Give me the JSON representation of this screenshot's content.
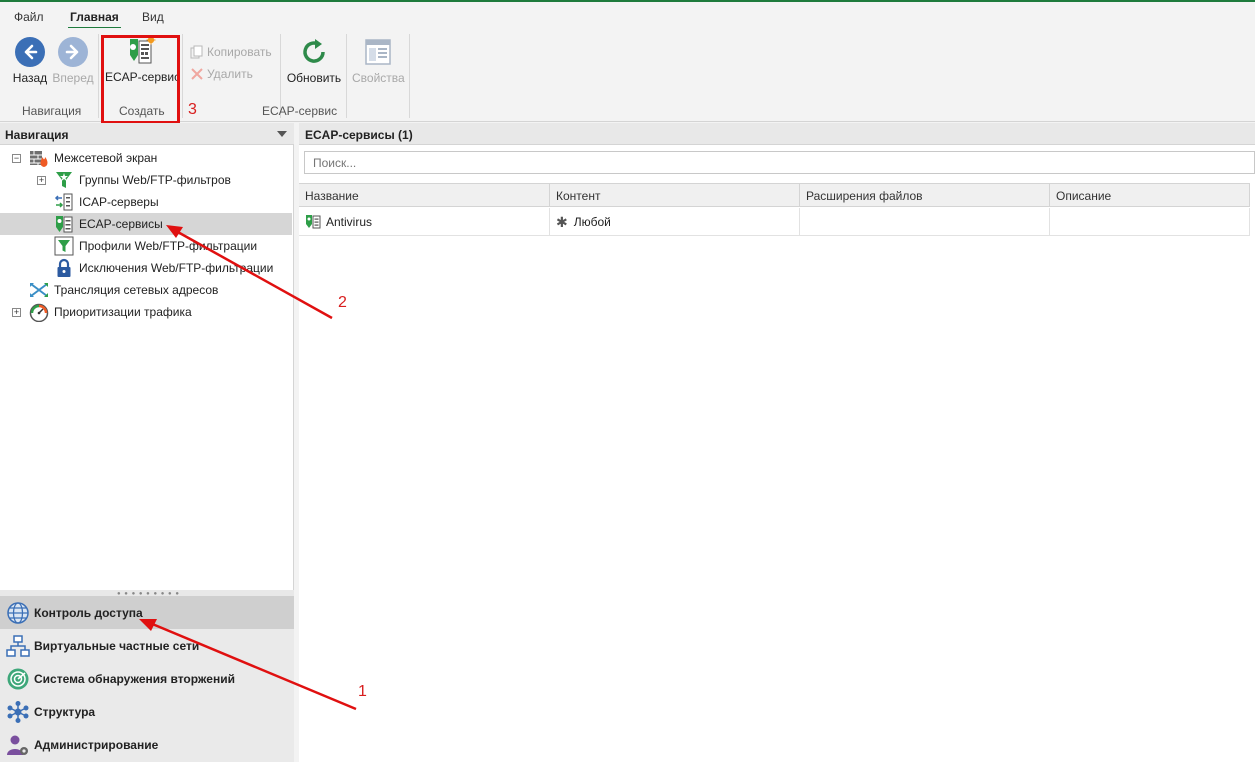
{
  "ribbon": {
    "tabs": [
      "Файл",
      "Главная",
      "Вид"
    ],
    "active_tab": "Главная",
    "buttons": {
      "back": "Назад",
      "forward": "Вперед",
      "ecap_service": "ECAP-сервис",
      "copy": "Копировать",
      "delete": "Удалить",
      "refresh": "Обновить",
      "properties": "Свойства"
    },
    "groups": {
      "navigation": "Навигация",
      "create": "Создать",
      "ecap": "ECAP-сервис"
    }
  },
  "navigation": {
    "header": "Навигация",
    "tree": [
      {
        "label": "Межсетевой экран",
        "icon": "firewall-icon",
        "expanded": true
      },
      {
        "label": "Группы Web/FTP-фильтров",
        "icon": "filter-group-icon",
        "expanded": false
      },
      {
        "label": "ICAP-серверы",
        "icon": "icap-server-icon"
      },
      {
        "label": "ECAP-сервисы",
        "icon": "ecap-service-icon",
        "selected": true
      },
      {
        "label": "Профили Web/FTP-фильтрации",
        "icon": "filter-profile-icon"
      },
      {
        "label": "Исключения Web/FTP-фильтрации",
        "icon": "lock-icon"
      },
      {
        "label": "Трансляция сетевых адресов",
        "icon": "nat-icon"
      },
      {
        "label": "Приоритизации трафика",
        "icon": "speedometer-icon",
        "expanded": false
      }
    ],
    "sections": [
      {
        "label": "Контроль доступа",
        "icon": "globe-icon",
        "active": true
      },
      {
        "label": "Виртуальные частные сети",
        "icon": "network-icon"
      },
      {
        "label": "Система обнаружения вторжений",
        "icon": "radar-icon"
      },
      {
        "label": "Структура",
        "icon": "structure-icon"
      },
      {
        "label": "Администрирование",
        "icon": "admin-icon"
      }
    ]
  },
  "content": {
    "title": "ECAP-сервисы (1)",
    "search_placeholder": "Поиск...",
    "columns": [
      "Название",
      "Контент",
      "Расширения файлов",
      "Описание"
    ],
    "rows": [
      {
        "name": "Antivirus",
        "content": "Любой",
        "extensions": "",
        "description": ""
      }
    ]
  },
  "annotations": [
    "1",
    "2",
    "3"
  ],
  "colors": {
    "accent": "#1e7b3c",
    "annotation": "#e01010",
    "nav_blue": "#3b6fb6"
  }
}
